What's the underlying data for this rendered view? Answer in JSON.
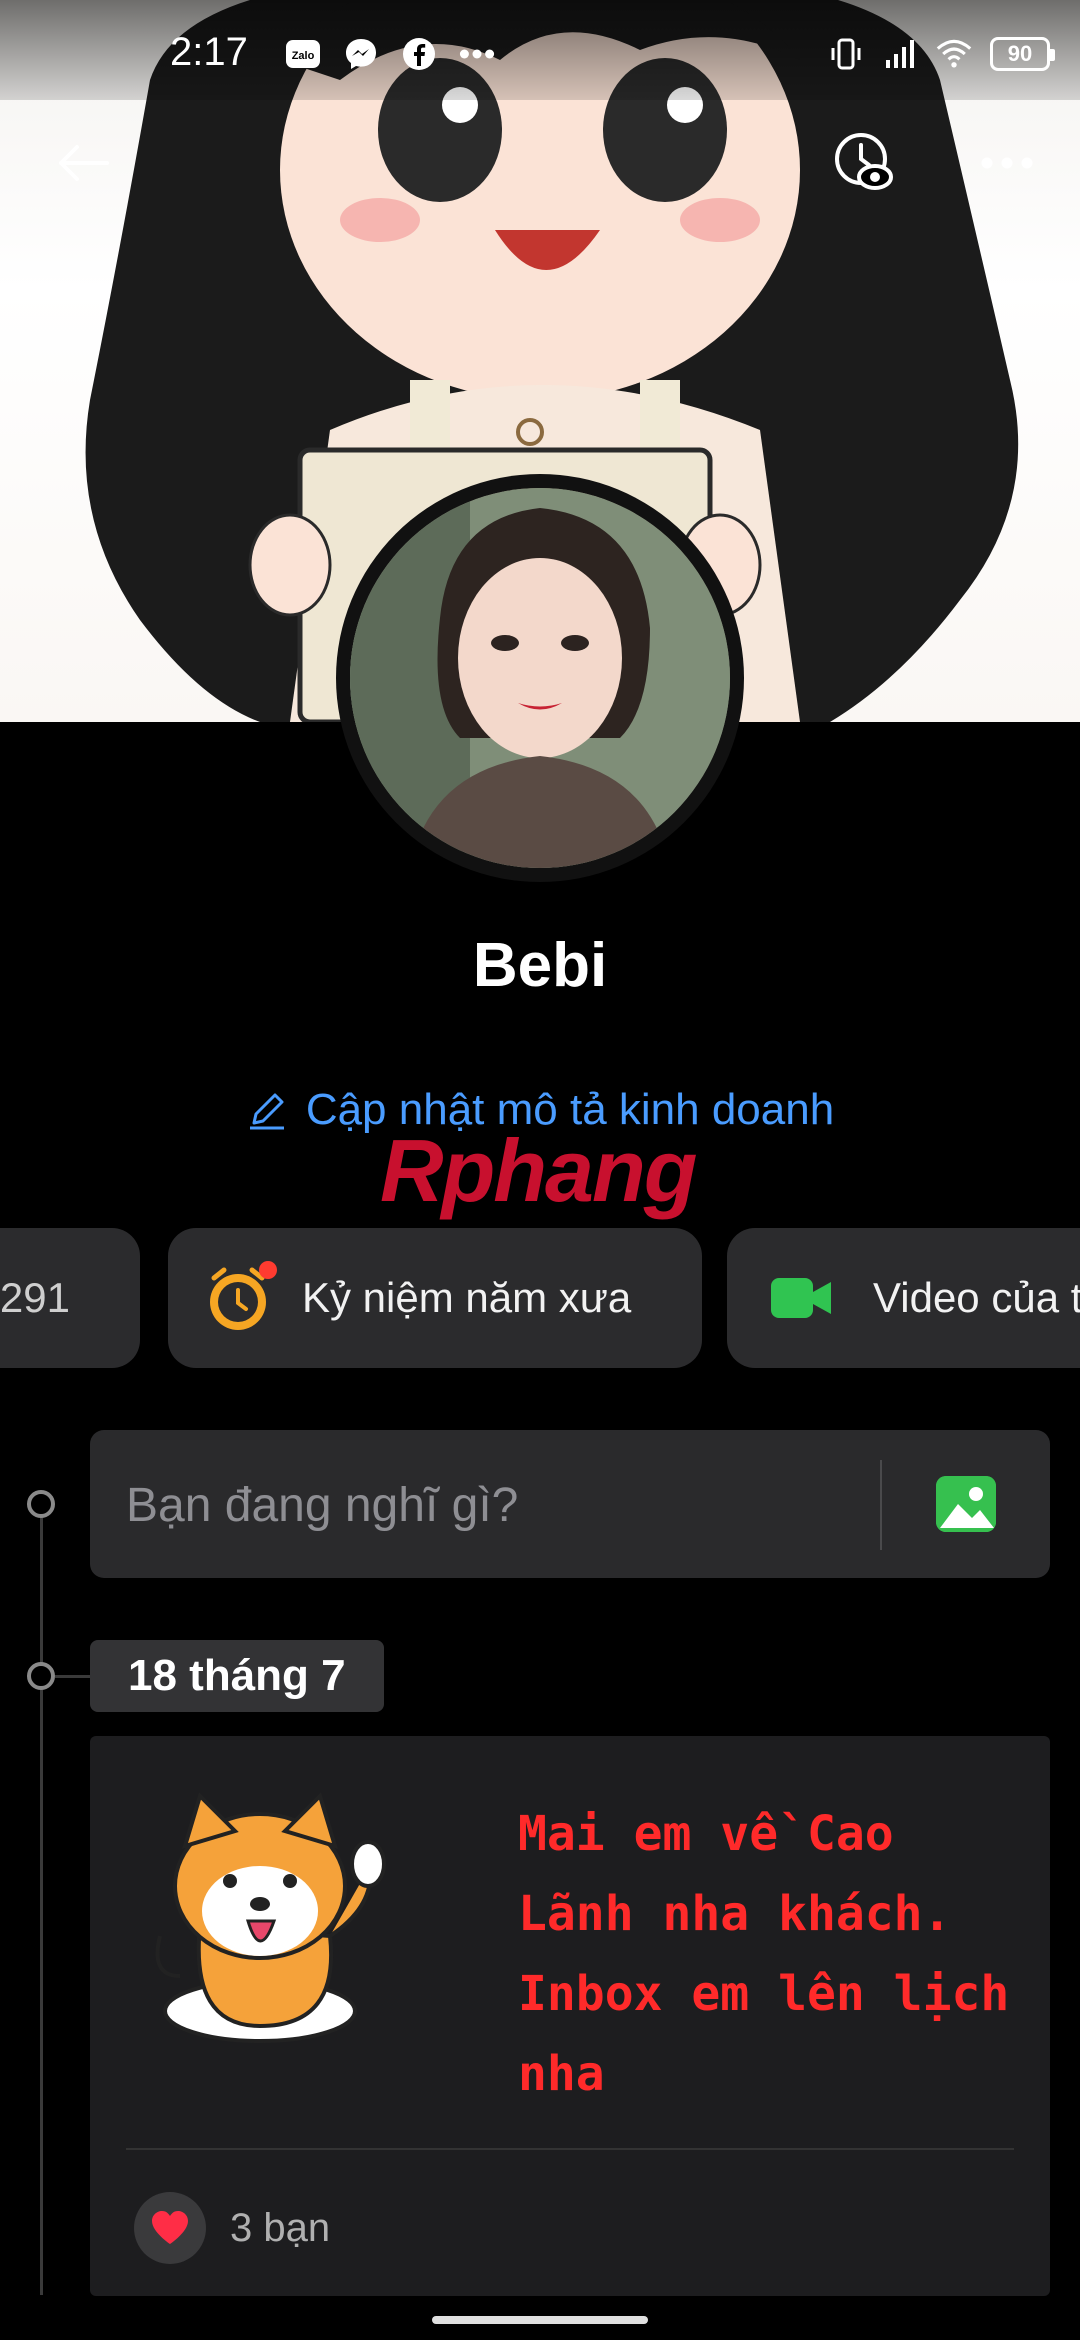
{
  "status_bar": {
    "time": "2:17",
    "battery": "90",
    "left_icons": [
      "zalo-icon",
      "messenger-icon",
      "facebook-icon",
      "more-dots-icon"
    ],
    "right_icons": [
      "vibrate-icon",
      "signal-icon",
      "wifi-icon",
      "battery-icon"
    ]
  },
  "top_nav": {
    "back_icon": "arrow-left-icon",
    "view_as_icon": "view-as-icon",
    "more_icon": "more-horizontal-icon"
  },
  "profile": {
    "name": "Bebi",
    "business_link": "Cập nhật mô tả kinh doanh",
    "watermark": "Rphang"
  },
  "chips": [
    {
      "label": "291"
    },
    {
      "label": "Kỷ niệm năm xưa",
      "icon": "alarm-clock-icon"
    },
    {
      "label": "Video của tô",
      "icon": "video-camera-icon"
    }
  ],
  "composer": {
    "placeholder": "Bạn đang nghĩ gì?",
    "photo_icon": "photo-icon"
  },
  "timeline": {
    "date_tag": "18 tháng 7"
  },
  "post": {
    "text": "Mai em về Cao Lãnh nha khách. Inbox em lên lịch nha",
    "reaction_text": "3 bạn",
    "reaction_icon": "heart-icon",
    "colors": {
      "text": "#ff2a2a"
    }
  },
  "colors": {
    "link": "#4a9cff",
    "chip_bg": "#2b2b2d",
    "background": "#000000"
  }
}
